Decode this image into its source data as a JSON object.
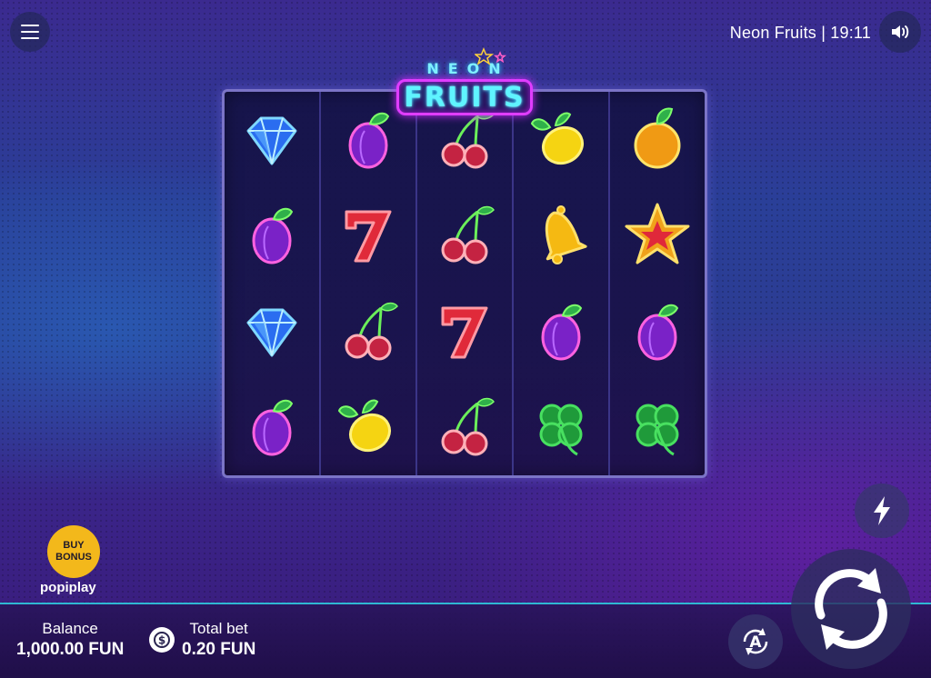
{
  "header": {
    "game_title": "Neon Fruits",
    "time": "19:11",
    "title_separator": " | "
  },
  "logo": {
    "top_word": "NEON",
    "main_word": "FRUITS"
  },
  "reels": [
    [
      "diamond",
      "plum",
      "diamond",
      "plum"
    ],
    [
      "plum",
      "seven",
      "cherry",
      "lemon"
    ],
    [
      "cherry",
      "cherry",
      "seven",
      "cherry"
    ],
    [
      "lemon",
      "bell",
      "plum",
      "clover"
    ],
    [
      "orange",
      "star",
      "plum",
      "clover"
    ]
  ],
  "buy_bonus": {
    "line1": "BUY",
    "line2": "BONUS"
  },
  "provider": "popiplay",
  "balance": {
    "label": "Balance",
    "value": "1,000.00 FUN"
  },
  "total_bet": {
    "label": "Total bet",
    "value": "0.20 FUN"
  },
  "icons": {
    "menu": "menu-icon",
    "sound": "speaker-icon",
    "turbo": "lightning-icon",
    "spin": "spin-icon",
    "autoplay": "autoplay-icon",
    "bet_settings": "coins-icon"
  },
  "colors": {
    "frame_border": "#7b74c7",
    "bottom_line": "#2fb7d3",
    "buy_bonus": "#f3b81b"
  }
}
